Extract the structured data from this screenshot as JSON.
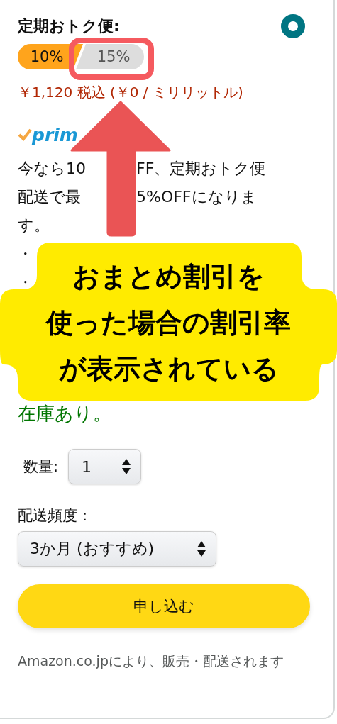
{
  "title": "定期おトク便:",
  "discount_tiers": [
    {
      "label": "10%",
      "selected": true
    },
    {
      "label": "15%",
      "selected": false
    }
  ],
  "price": "￥1,120 税込 (￥0 / ミリリットル)",
  "prime_logo": "prim",
  "description_lines": [
    [
      "今なら10",
      "FF、定期おトク便"
    ],
    [
      "配送で最",
      "5%OFFになりま"
    ],
    [
      "す。"
    ]
  ],
  "bullets": [
    "・",
    "・"
  ],
  "stock": "在庫あり。",
  "quantity": {
    "label": "数量:",
    "value": "1"
  },
  "frequency": {
    "label": "配送頻度：",
    "value": "3か月 (おすすめ)"
  },
  "subscribe_button": "申し込む",
  "seller_note": "Amazon.co.jpにより、販売・配送されます",
  "annotation": {
    "lines": [
      "おまとめ割引を",
      "使った場合の割引率",
      "が表示されている"
    ]
  }
}
